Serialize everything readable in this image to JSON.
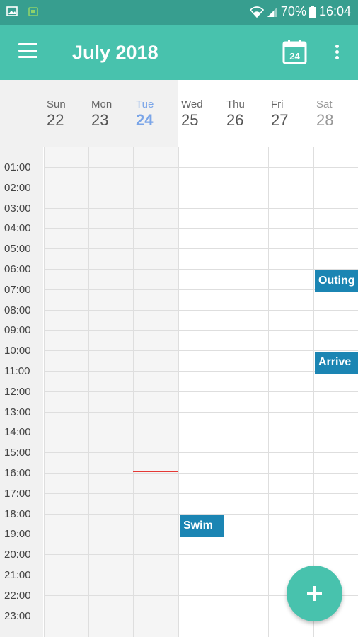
{
  "status_bar": {
    "battery": "70%",
    "time": "16:04"
  },
  "app_bar": {
    "title": "July 2018",
    "today_badge": "24"
  },
  "days": [
    {
      "name": "Sun",
      "num": "22"
    },
    {
      "name": "Mon",
      "num": "23"
    },
    {
      "name": "Tue",
      "num": "24",
      "today": true
    },
    {
      "name": "Wed",
      "num": "25"
    },
    {
      "name": "Thu",
      "num": "26"
    },
    {
      "name": "Fri",
      "num": "27"
    },
    {
      "name": "Sat",
      "num": "28"
    }
  ],
  "times": [
    "01:00",
    "02:00",
    "03:00",
    "04:00",
    "05:00",
    "06:00",
    "07:00",
    "08:00",
    "09:00",
    "10:00",
    "11:00",
    "12:00",
    "13:00",
    "14:00",
    "15:00",
    "16:00",
    "17:00",
    "18:00",
    "19:00",
    "20:00",
    "21:00",
    "22:00",
    "23:00"
  ],
  "events": [
    {
      "title": "Outing",
      "day": "Sat",
      "start": "06:00",
      "end": "07:00"
    },
    {
      "title": "Arrive",
      "day": "Sat",
      "start": "10:00",
      "end": "11:00"
    },
    {
      "title": "Swim",
      "day": "Wed",
      "start": "18:00",
      "end": "19:00"
    }
  ],
  "colors": {
    "primary": "#48c2ad",
    "status_bar": "#379e8f",
    "today": "#7aa5e8",
    "event": "#1b85b3",
    "now_line": "#e53935"
  }
}
